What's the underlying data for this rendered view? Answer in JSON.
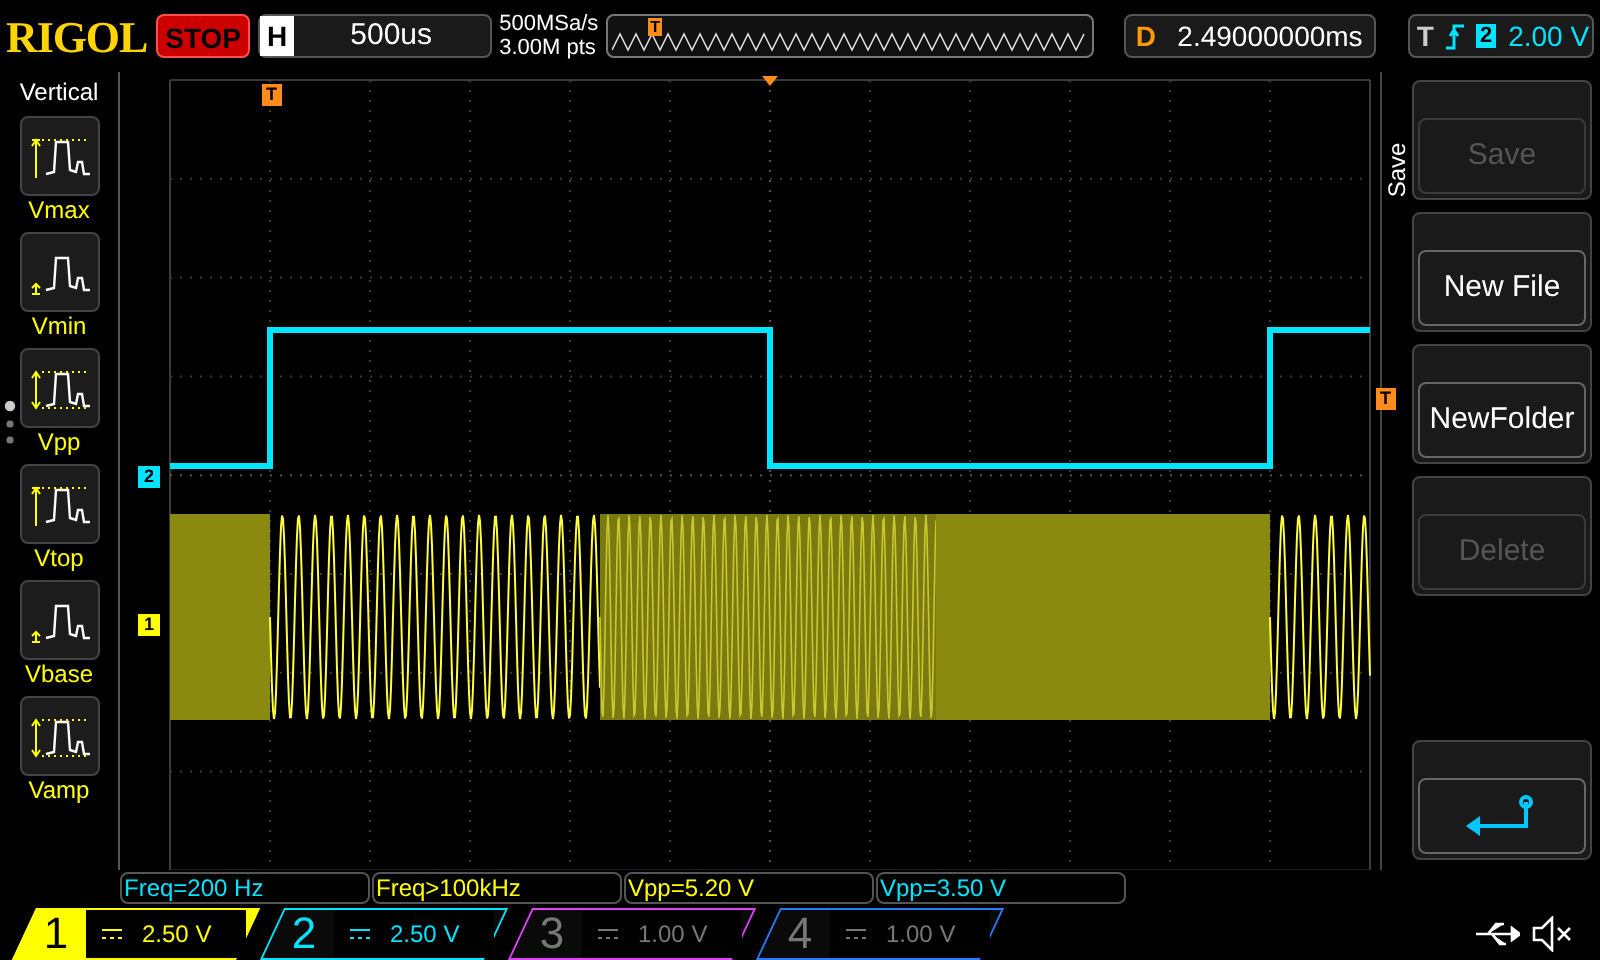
{
  "top_bar": {
    "brand": "RIGOL",
    "run_state": "STOP",
    "timebase": {
      "label": "H",
      "value": "500us"
    },
    "sample_rate": "500MSa/s",
    "memory_depth": "3.00M pts",
    "delay": {
      "label": "D",
      "value": "2.49000000ms"
    },
    "trigger": {
      "label": "T",
      "source": "2",
      "level": "2.00 V"
    }
  },
  "left_menu": {
    "title": "Vertical",
    "items": [
      {
        "label": "Vmax",
        "kind": "max"
      },
      {
        "label": "Vmin",
        "kind": "min"
      },
      {
        "label": "Vpp",
        "kind": "pp"
      },
      {
        "label": "Vtop",
        "kind": "top"
      },
      {
        "label": "Vbase",
        "kind": "base"
      },
      {
        "label": "Vamp",
        "kind": "amp"
      }
    ]
  },
  "scope": {
    "overview_trigger_marker": "T",
    "trigger_marker": "T",
    "right_trigger_marker": "T",
    "channel_markers": [
      {
        "label": "2",
        "color": "#00e5ff"
      },
      {
        "label": "1",
        "color": "#ffff00"
      }
    ]
  },
  "right_menu": {
    "title": "Save",
    "buttons": [
      {
        "label": "Save",
        "disabled": true
      },
      {
        "label": "New File",
        "disabled": false
      },
      {
        "label": "NewFolder",
        "disabled": false
      },
      {
        "label": "Delete",
        "disabled": true
      }
    ]
  },
  "measurements": [
    {
      "text": "Freq=200 Hz",
      "color": "#00e5ff"
    },
    {
      "text": "Freq>100kHz",
      "color": "#ffff00"
    },
    {
      "text": "Vpp=5.20 V",
      "color": "#ffff00"
    },
    {
      "text": "Vpp=3.50 V",
      "color": "#00e5ff"
    }
  ],
  "channels": [
    {
      "number": "1",
      "scale": "2.50 V",
      "selected": true,
      "on": true,
      "color": "#ffff00"
    },
    {
      "number": "2",
      "scale": "2.50 V",
      "selected": false,
      "on": true,
      "color": "#00e5ff"
    },
    {
      "number": "3",
      "scale": "1.00 V",
      "selected": false,
      "on": false,
      "color": "#e040fb"
    },
    {
      "number": "4",
      "scale": "1.00 V",
      "selected": false,
      "on": false,
      "color": "#2979ff"
    }
  ]
}
